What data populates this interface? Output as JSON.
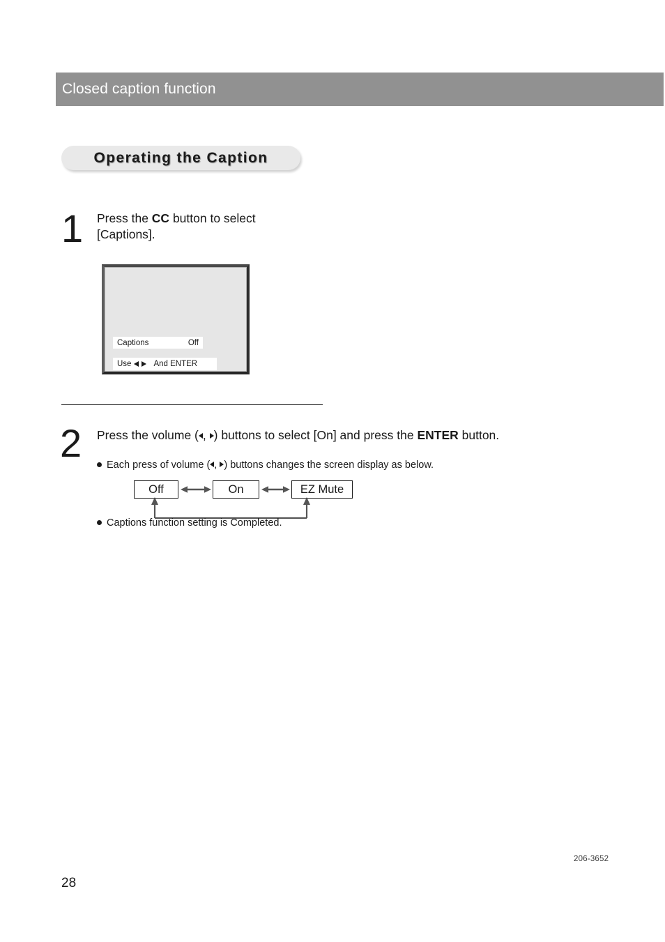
{
  "header": {
    "title": "Closed caption function",
    "bar_color": "#919191",
    "text_color": "#ffffff"
  },
  "section": {
    "badge_label": "Operating the Caption",
    "badge_color": "#e9e9e9"
  },
  "steps": [
    {
      "number": "1",
      "text_line1": "Press the CC button to select",
      "text_line2": "[Captions].",
      "text_prefix": "Press   the   ",
      "text_bold": "CC",
      "text_suffix": "   button   to   select",
      "text_second_line": "[Captions]."
    },
    {
      "number": "2",
      "text_prefix": "Press the volume (",
      "text_mid": ") buttons to select [On] and press the ",
      "text_bold": "ENTER",
      "text_suffix": " button.",
      "bullet1_prefix": "Each press of volume (",
      "bullet1_suffix": ") buttons changes the screen display as below.",
      "bullet2": "Captions function setting is Completed."
    }
  ],
  "tv_screen": {
    "osd_label": "Captions",
    "osd_value": "Off",
    "hint_prefix": "Use",
    "hint_suffix": "And ENTER",
    "screen_color": "#e6e6e6",
    "osd_bar_color": "#ffffff"
  },
  "flow_diagram": {
    "boxes": [
      {
        "label": "Off"
      },
      {
        "label": "On"
      },
      {
        "label": "EZ Mute"
      }
    ],
    "arrow_style": "double-headed",
    "loop_back": "EZ Mute to Off"
  },
  "footer": {
    "doc_code": "206-3652",
    "page_number": "28"
  }
}
